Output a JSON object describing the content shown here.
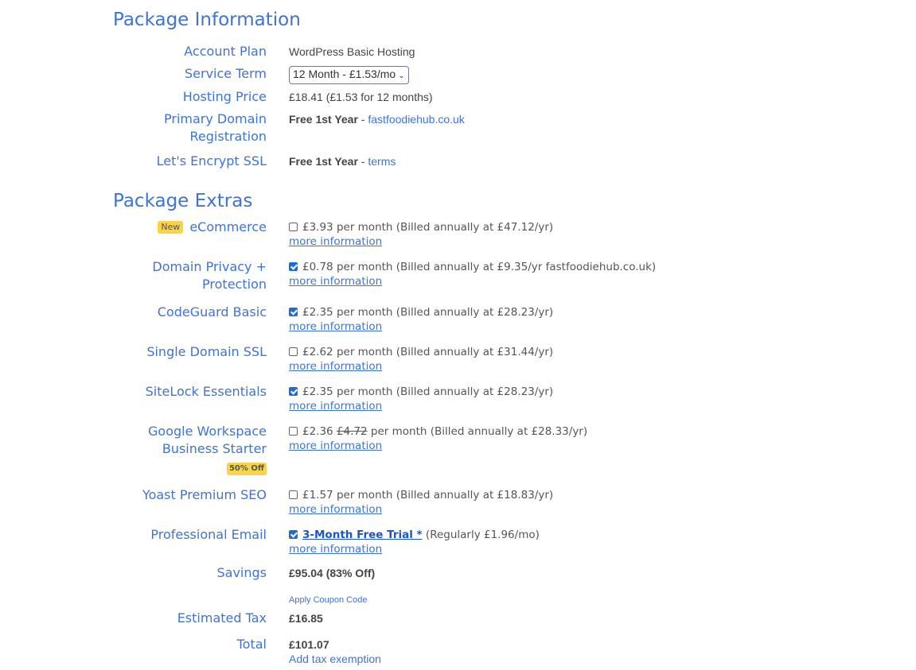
{
  "package_info": {
    "title": "Package Information",
    "account_plan": {
      "label": "Account Plan",
      "value": "WordPress Basic Hosting"
    },
    "service_term": {
      "label": "Service Term",
      "selected": "12 Month - £1.53/mo"
    },
    "hosting_price": {
      "label": "Hosting Price",
      "value": "£18.41 (£1.53 for 12 months)"
    },
    "primary_domain": {
      "label_line1": "Primary Domain",
      "label_line2": "Registration",
      "bold": "Free 1st Year",
      "sep": " - ",
      "link": "fastfoodiehub.co.uk"
    },
    "ssl": {
      "label": "Let's Encrypt SSL",
      "bold": "Free 1st Year",
      "sep": " - ",
      "link": "terms"
    }
  },
  "package_extras": {
    "title": "Package Extras",
    "more_info": "more information",
    "items": [
      {
        "badge": "New",
        "label": "eCommerce",
        "checked": false,
        "text": "£3.93 per month (Billed annually at £47.12/yr)"
      },
      {
        "label_line1": "Domain Privacy +",
        "label_line2": "Protection",
        "checked": true,
        "text": "£0.78 per month (Billed annually at £9.35/yr fastfoodiehub.co.uk)"
      },
      {
        "label": "CodeGuard Basic",
        "checked": true,
        "text": "£2.35 per month (Billed annually at £28.23/yr)"
      },
      {
        "label": "Single Domain SSL",
        "checked": false,
        "text": "£2.62 per month (Billed annually at £31.44/yr)"
      },
      {
        "label": "SiteLock Essentials",
        "checked": true,
        "text": "£2.35 per month (Billed annually at £28.23/yr)"
      },
      {
        "label_line1": "Google Workspace",
        "label_line2": "Business Starter",
        "badge": "50% Off",
        "checked": false,
        "price": "£2.36",
        "old_price": "£4.72",
        "text": "per month (Billed annually at £28.33/yr)"
      },
      {
        "label": "Yoast Premium SEO",
        "checked": false,
        "text": "£1.57 per month (Billed annually at £18.83/yr)"
      },
      {
        "label": "Professional Email",
        "checked": true,
        "trial": "3-Month Free Trial *",
        "text": "(Regularly £1.96/mo)"
      }
    ]
  },
  "summary": {
    "savings": {
      "label": "Savings",
      "value": "£95.04 (83% Off)"
    },
    "coupon_link": "Apply Coupon Code",
    "tax": {
      "label": "Estimated Tax",
      "value": "£16.85"
    },
    "total": {
      "label": "Total",
      "value": "£101.07"
    },
    "tax_exemption_link": "Add tax exemption"
  },
  "colors": {
    "accent": "#3f74d0",
    "badge": "#f9d34a",
    "checkbox": "#1a6cd8"
  }
}
